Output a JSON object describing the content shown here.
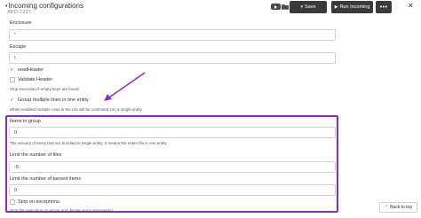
{
  "header": {
    "title": "Incoming configurations",
    "subtitle": "APD-2337",
    "save_label": "Save",
    "save_icon": "chevron-down-icon",
    "run_label": "Run Incoming",
    "run_icon": "play-icon",
    "more_label": "•••",
    "close_label": "✕"
  },
  "form": {
    "enclosure": {
      "label": "Enclosure",
      "value": "\""
    },
    "escape": {
      "label": "Escape",
      "value": "\\"
    },
    "read_header": {
      "label": "readHeader",
      "checked": true
    },
    "validate_header": {
      "label": "Validate Header",
      "checked": false,
      "help": "Stop execution if empty keys are found."
    },
    "group_multiple": {
      "label": "Group multiple lines in one entity.",
      "checked": true,
      "help": "When enabled multiple rows in the csv will be combined into a single entity."
    },
    "items_in_group": {
      "label": "Items in group",
      "value": "0",
      "help": "The amount of items that are bundled in single entity. 0 means the entire file in one entity."
    },
    "limit_files": {
      "label": "Limit the number of files",
      "value": "-5"
    },
    "limit_parsed": {
      "label": "Limit the number of parsed items",
      "value": "0"
    },
    "stop_on_exceptions": {
      "label": "Stop on exceptions.",
      "checked": false,
      "help": "Stop the execution on errors and display error message(s)."
    }
  },
  "back_to_top": {
    "label": "Back to top"
  },
  "colors": {
    "accent": "#8a2bc9",
    "button_bg": "#3a3a3a"
  }
}
